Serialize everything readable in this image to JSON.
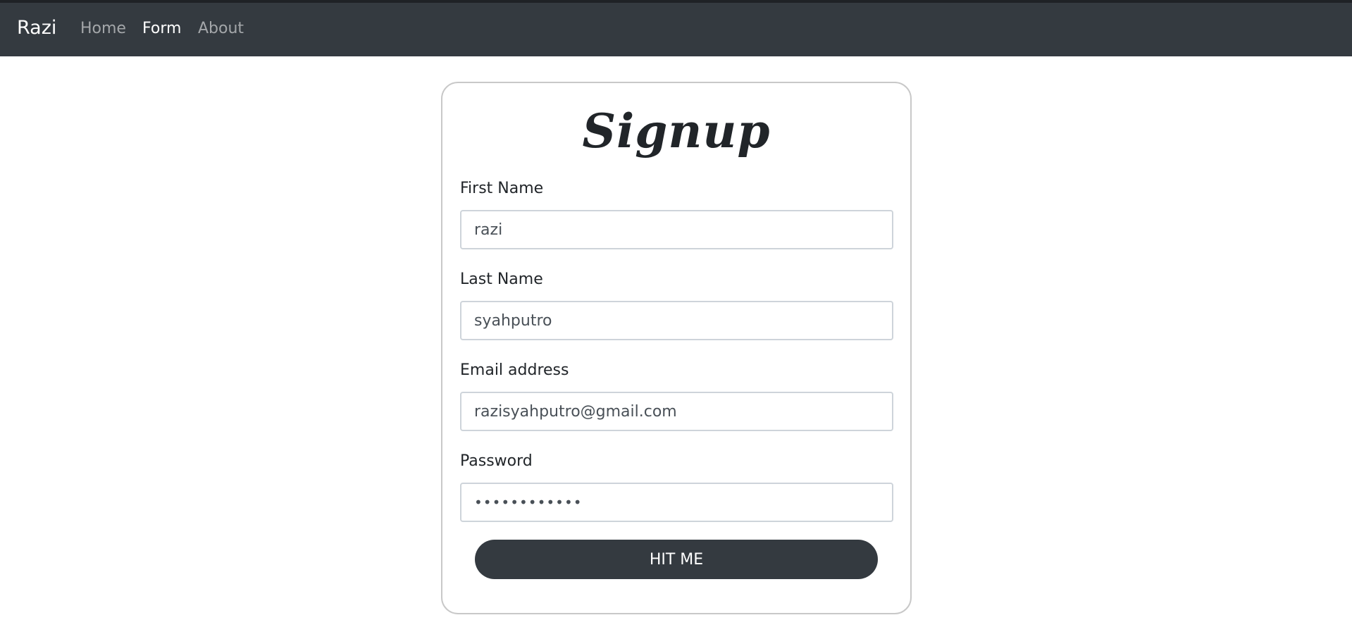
{
  "navbar": {
    "brand": "Razi",
    "links": [
      {
        "label": "Home"
      },
      {
        "label": "Form",
        "active": true
      },
      {
        "label": "About"
      }
    ]
  },
  "form": {
    "title": "Signup",
    "fields": [
      {
        "label": "First Name",
        "value": "razi",
        "type": "text"
      },
      {
        "label": "Last Name",
        "value": "syahputro",
        "type": "text"
      },
      {
        "label": "Email address",
        "value": "razisyahputro@gmail.com",
        "type": "email"
      },
      {
        "label": "Password",
        "value": "razisyahputr",
        "type": "password"
      }
    ],
    "submit_label": "HIT ME"
  },
  "colors": {
    "navbar_bg": "#343a40",
    "button_bg": "#343a40",
    "card_border": "#c8c8c8"
  }
}
